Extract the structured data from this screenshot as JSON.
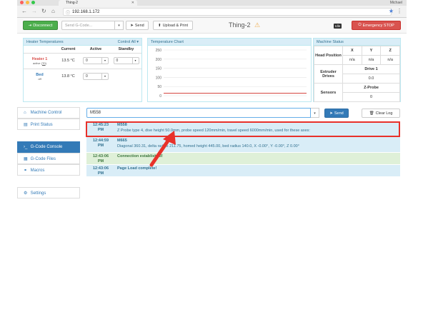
{
  "browser": {
    "tab_title": "Thing-2",
    "url": "192.168.1.172",
    "profile": "Michael",
    "colors": {
      "close": "#fc605c",
      "minimize": "#fdbc40",
      "zoom": "#34c84a"
    }
  },
  "toolbar": {
    "disconnect_label": "Disconnect",
    "gcode_placeholder": "Send G-Code...",
    "send_label": "Send",
    "upload_label": "Upload & Print",
    "machine_name": "Thing-2",
    "status_badge": "Idle",
    "emergency_label": "Emergency STOP"
  },
  "heaters": {
    "title": "Heater Temperatures",
    "control_all": "Control All",
    "columns": [
      "",
      "Current",
      "Active",
      "Standby"
    ],
    "rows": [
      {
        "name": "Heater 1",
        "state": "active",
        "tool": "T0",
        "current": "13.5 °C",
        "active": "0",
        "standby": "0",
        "color": "#d9534f"
      },
      {
        "name": "Bed",
        "state": "off",
        "tool": "",
        "current": "13.8 °C",
        "active": "0",
        "standby": "",
        "color": "#337ab7"
      }
    ]
  },
  "temp_chart": {
    "title": "Temperature Chart",
    "chart_data": {
      "type": "line",
      "title": "Temperature Chart",
      "ylim": [
        0,
        250
      ],
      "y_ticks": [
        "250",
        "200",
        "150",
        "100",
        "50",
        "0"
      ],
      "series": [
        {
          "values": [
            13.5,
            13.5,
            13.5,
            13.5,
            13.5
          ]
        }
      ],
      "grid": true
    }
  },
  "machine_status": {
    "title": "Machine Status",
    "head_position_label": "Head Position",
    "axes": [
      "X",
      "Y",
      "Z"
    ],
    "axis_values": [
      "n/a",
      "n/a",
      "n/a"
    ],
    "extruder_drives_label": "Extruder Drives",
    "drive_label": "Drive 1",
    "drive_value": "0.0",
    "sensors_label": "Sensors",
    "zprobe_label": "Z-Probe",
    "zprobe_value": "0"
  },
  "sidebar": {
    "items": [
      {
        "label": "Machine Control",
        "icon": "home-icon"
      },
      {
        "label": "Print Status",
        "icon": "print-icon"
      },
      {
        "label": "G-Code Console",
        "icon": "console-icon"
      },
      {
        "label": "G-Code Files",
        "icon": "files-icon"
      },
      {
        "label": "Macros",
        "icon": "link-icon"
      },
      {
        "label": "Settings",
        "icon": "gear-icon"
      }
    ]
  },
  "console": {
    "input_value": "M558",
    "send_label": "Send",
    "clear_label": "Clear Log",
    "log": [
      {
        "time": "12:45:23",
        "ampm": "PM",
        "cmd": "M558",
        "msg": "Z Probe type 4, dive height 50.0mm, probe speed 120mm/min, travel speed 6000mm/min, used for these axes:",
        "kind": "info"
      },
      {
        "time": "12:44:59",
        "ampm": "PM",
        "cmd": "M665",
        "msg": "Diagonal 360.31, delta radius 211.75, homed height 445.00, bed radius 140.0, X -0.00°, Y -0.00°, Z 0.00°",
        "kind": "info"
      },
      {
        "time": "12:43:06",
        "ampm": "PM",
        "cmd": "Connection established!",
        "msg": "",
        "kind": "success"
      },
      {
        "time": "12:43:06",
        "ampm": "PM",
        "cmd": "Page Load complete!",
        "msg": "",
        "kind": "info"
      }
    ]
  }
}
